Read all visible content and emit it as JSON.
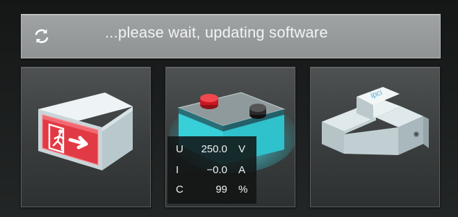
{
  "status": {
    "message": "...please wait, updating software",
    "icon": "refresh-icon"
  },
  "devices": [
    {
      "name": "emergency-exit-light",
      "icon": "exit-sign-icon"
    },
    {
      "name": "battery",
      "icon": "battery-icon"
    },
    {
      "name": "din-rail-module",
      "icon": "din-rail-module-icon"
    }
  ],
  "battery_readout": {
    "voltage": {
      "symbol": "U",
      "value": "250.0",
      "unit": "V"
    },
    "current": {
      "symbol": "I",
      "value": "−0.0",
      "unit": "A"
    },
    "capacity": {
      "symbol": "C",
      "value": "99",
      "unit": "%"
    }
  },
  "colors": {
    "status_bar": "#9a9e9e",
    "exit_sign_red": "#e23a44",
    "battery_glow": "#3fe3ee",
    "battery_terminal_red": "#d8202a"
  }
}
